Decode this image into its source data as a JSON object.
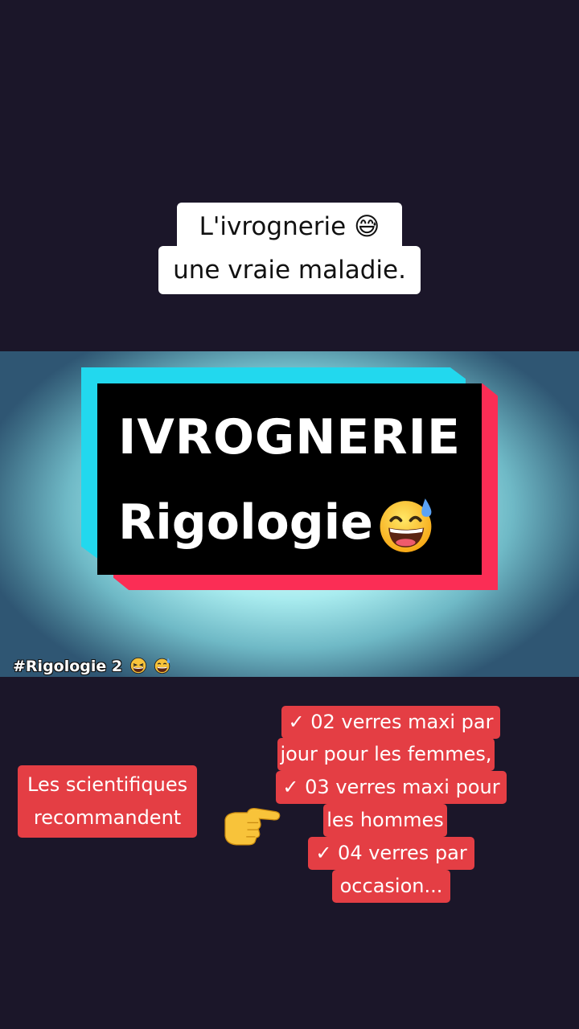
{
  "caption": {
    "line1": "L'ivrognerie 😅",
    "line2": "une vraie maladie."
  },
  "video": {
    "title_line1": "IVROGNERIE",
    "title_line2": "Rigologie",
    "hashtag": "#Rigologie 2",
    "emoji_name": "grinning-face-with-sweat-icon"
  },
  "overlay": {
    "left_line1": "Les scientifiques",
    "left_line2": "recommandent",
    "pointer_icon": "backhand-index-pointing-right-icon",
    "list_lines": [
      "✓ 02 verres maxi par",
      "jour pour les femmes,",
      "✓ 03 verres maxi pour",
      "les hommes",
      "✓ 04 verres par",
      "occasion..."
    ]
  },
  "colors": {
    "background": "#1b1629",
    "label_red": "#e43e44",
    "frame_cyan": "#22d8ee",
    "frame_red": "#fb2d55"
  }
}
